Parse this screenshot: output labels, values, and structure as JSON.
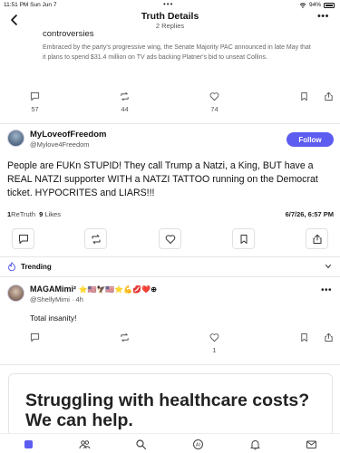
{
  "status_bar": {
    "time": "11:51 PM",
    "date": "Sun Jun 7",
    "dots": "•••",
    "battery": "94%"
  },
  "header": {
    "title": "Truth Details",
    "subtitle": "2 Replies",
    "more": "•••"
  },
  "quoted_post": {
    "title": "controversies",
    "body": "Embraced by the party's progressive wing, the Senate Majority PAC announced in late May that it plans to spend $31.4 million on TV ads backing Platner's bid to unseat Collins.",
    "stats": {
      "replies": "57",
      "retruths": "44",
      "likes": "74"
    }
  },
  "main_post": {
    "author_name": "MyLoveofFreedom",
    "author_handle": "@Mylove4Freedom",
    "follow_label": "Follow",
    "text": "People are FUKn STUPID! They call Trump a Natzi, a King, BUT have a REAL NATZI supporter WITH a NATZI TATTOO running on the Democrat ticket. HYPOCRITES and LIARS!!!",
    "retruth_count": "1",
    "retruth_label": "ReTruth",
    "likes_count": "9",
    "likes_label": "Likes",
    "date": "6/7/26, 6:57 PM"
  },
  "trending": {
    "label": "Trending"
  },
  "reply": {
    "author_name": "MAGAMimi²",
    "author_emojis": "⭐🇺🇸🦅🇺🇸⭐💪💋❤️⊕",
    "author_handle": "@ShellyMimi",
    "time": "4h",
    "text": "Total insanity!",
    "likes": "1",
    "more": "•••"
  },
  "ad": {
    "text": "Struggling with healthcare costs? We can help."
  },
  "colors": {
    "accent": "#5d5cf0",
    "text": "#111111",
    "muted": "#555555"
  },
  "tabbar": {
    "items": [
      "home-icon",
      "people-icon",
      "search-icon",
      "ai-icon",
      "bell-icon",
      "mail-icon"
    ]
  }
}
